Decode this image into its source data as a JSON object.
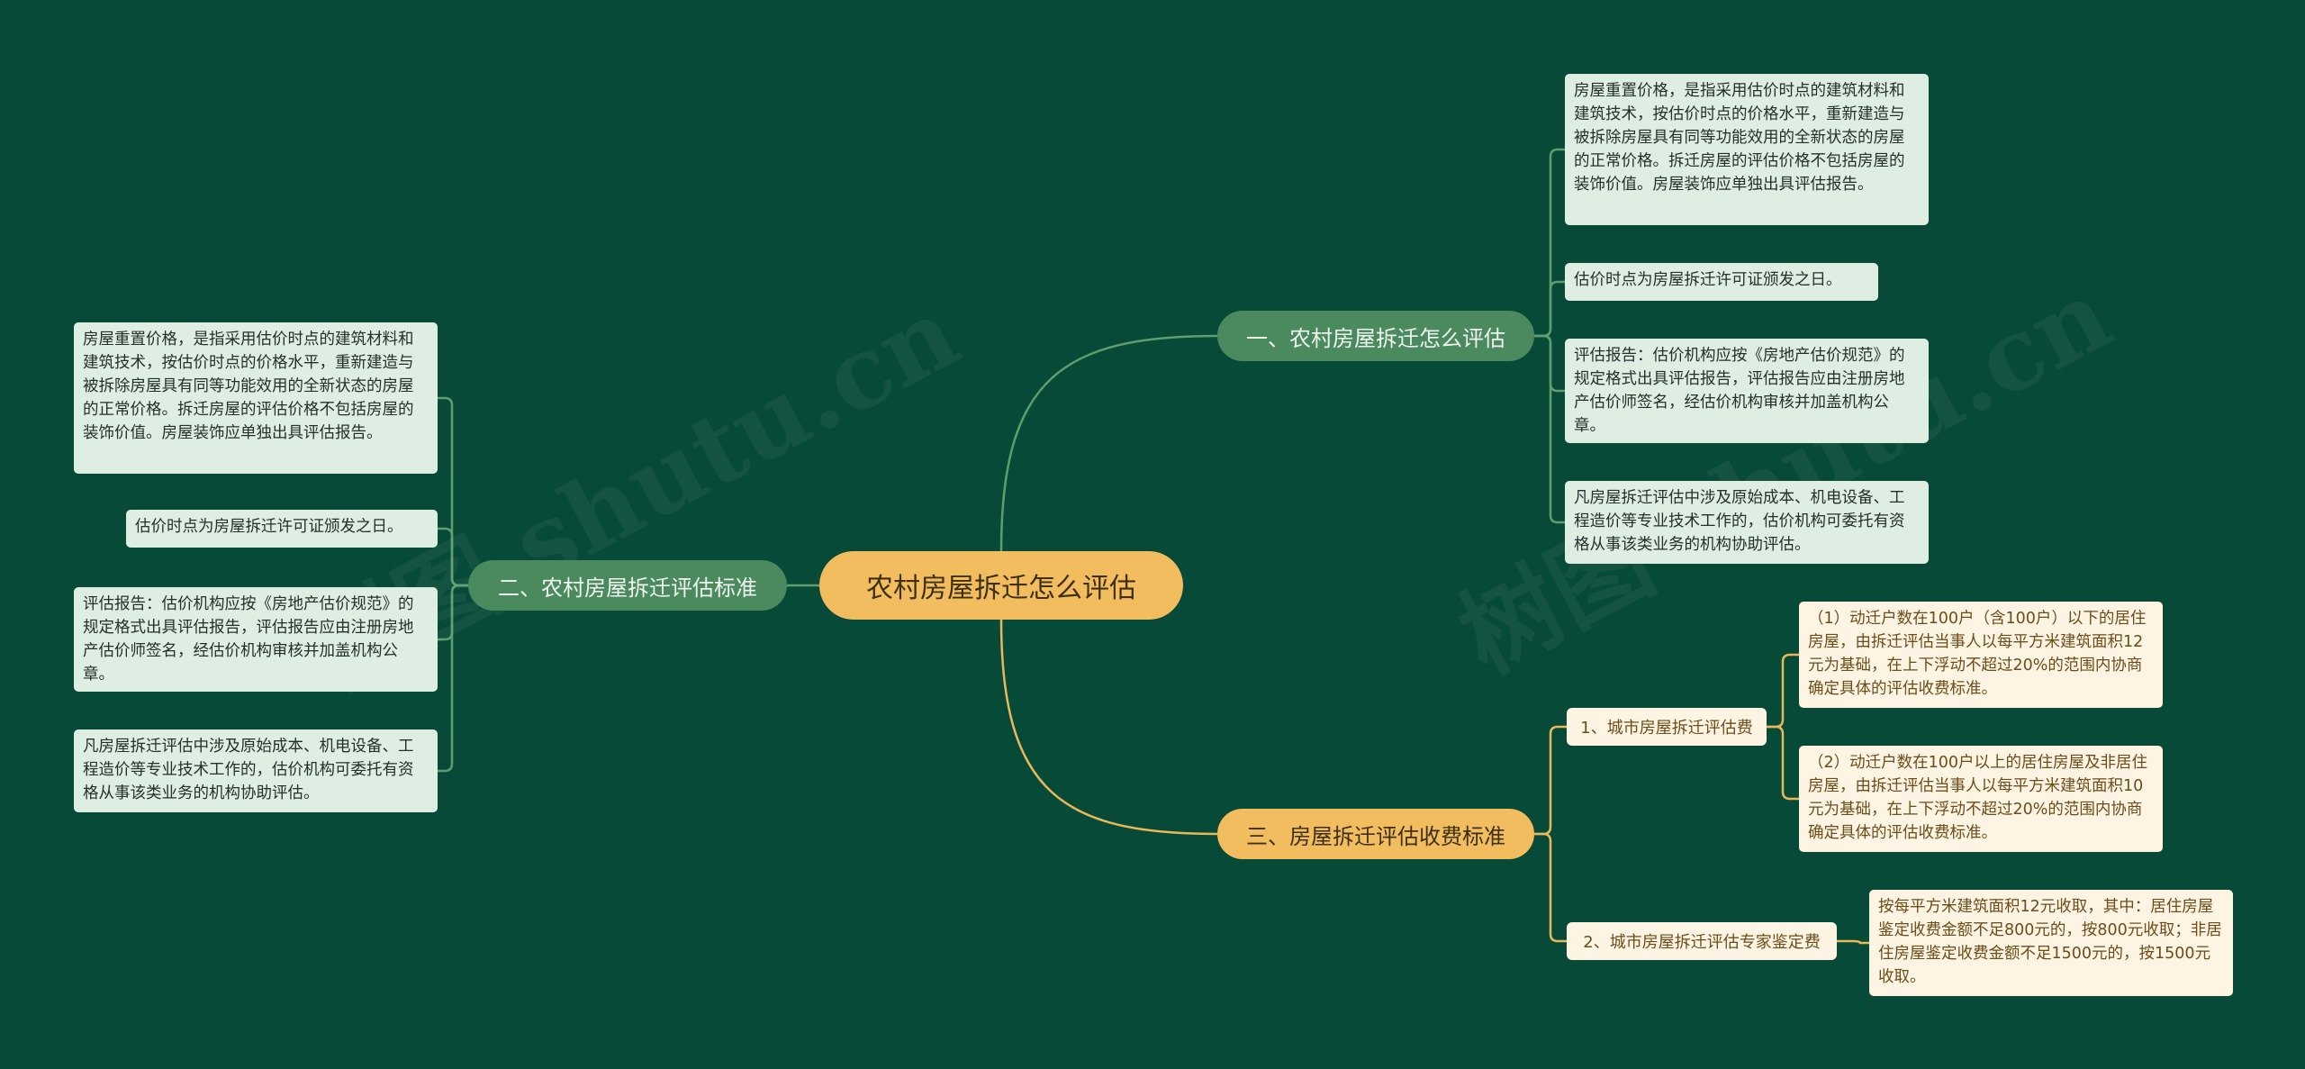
{
  "root": {
    "label": "农村房屋拆迁怎么评估"
  },
  "watermark": "树图 shutu.cn",
  "branches": {
    "b1": {
      "label": "一、农村房屋拆迁怎么评估",
      "leaves": [
        "房屋重置价格，是指采用估价时点的建筑材料和建筑技术，按估价时点的价格水平，重新建造与被拆除房屋具有同等功能效用的全新状态的房屋的正常价格。拆迁房屋的评估价格不包括房屋的装饰价值。房屋装饰应单独出具评估报告。",
        "估价时点为房屋拆迁许可证颁发之日。",
        "评估报告：估价机构应按《房地产估价规范》的规定格式出具评估报告，评估报告应由注册房地产估价师签名，经估价机构审核并加盖机构公章。",
        "凡房屋拆迁评估中涉及原始成本、机电设备、工程造价等专业技术工作的，估价机构可委托有资格从事该类业务的机构协助评估。"
      ]
    },
    "b2": {
      "label": "二、农村房屋拆迁评估标准",
      "leaves": [
        "房屋重置价格，是指采用估价时点的建筑材料和建筑技术，按估价时点的价格水平，重新建造与被拆除房屋具有同等功能效用的全新状态的房屋的正常价格。拆迁房屋的评估价格不包括房屋的装饰价值。房屋装饰应单独出具评估报告。",
        "估价时点为房屋拆迁许可证颁发之日。",
        "评估报告：估价机构应按《房地产估价规范》的规定格式出具评估报告，评估报告应由注册房地产估价师签名，经估价机构审核并加盖机构公章。",
        "凡房屋拆迁评估中涉及原始成本、机电设备、工程造价等专业技术工作的，估价机构可委托有资格从事该类业务的机构协助评估。"
      ]
    },
    "b3": {
      "label": "三、房屋拆迁评估收费标准",
      "subs": [
        {
          "label": "1、城市房屋拆迁评估费",
          "leaves": [
            "（1）动迁户数在100户（含100户）以下的居住房屋，由拆迁评估当事人以每平方米建筑面积12元为基础，在上下浮动不超过20%的范围内协商确定具体的评估收费标准。",
            "（2）动迁户数在100户以上的居住房屋及非居住房屋，由拆迁评估当事人以每平方米建筑面积10元为基础，在上下浮动不超过20%的范围内协商确定具体的评估收费标准。"
          ]
        },
        {
          "label": "2、城市房屋拆迁评估专家鉴定费",
          "leaves": [
            "按每平方米建筑面积12元收取，其中：居住房屋鉴定收费金额不足800元的，按800元收取；非居住房屋鉴定收费金额不足1500元的，按1500元收取。"
          ]
        }
      ]
    }
  },
  "colors": {
    "background": "#084a38",
    "root": "#f2bd5e",
    "green_branch": "#4a8a5e",
    "green_leaf": "#deeee3",
    "yellow_leaf": "#fdf4e3",
    "green_line": "#5f9e6c",
    "yellow_line": "#e9b85a"
  }
}
